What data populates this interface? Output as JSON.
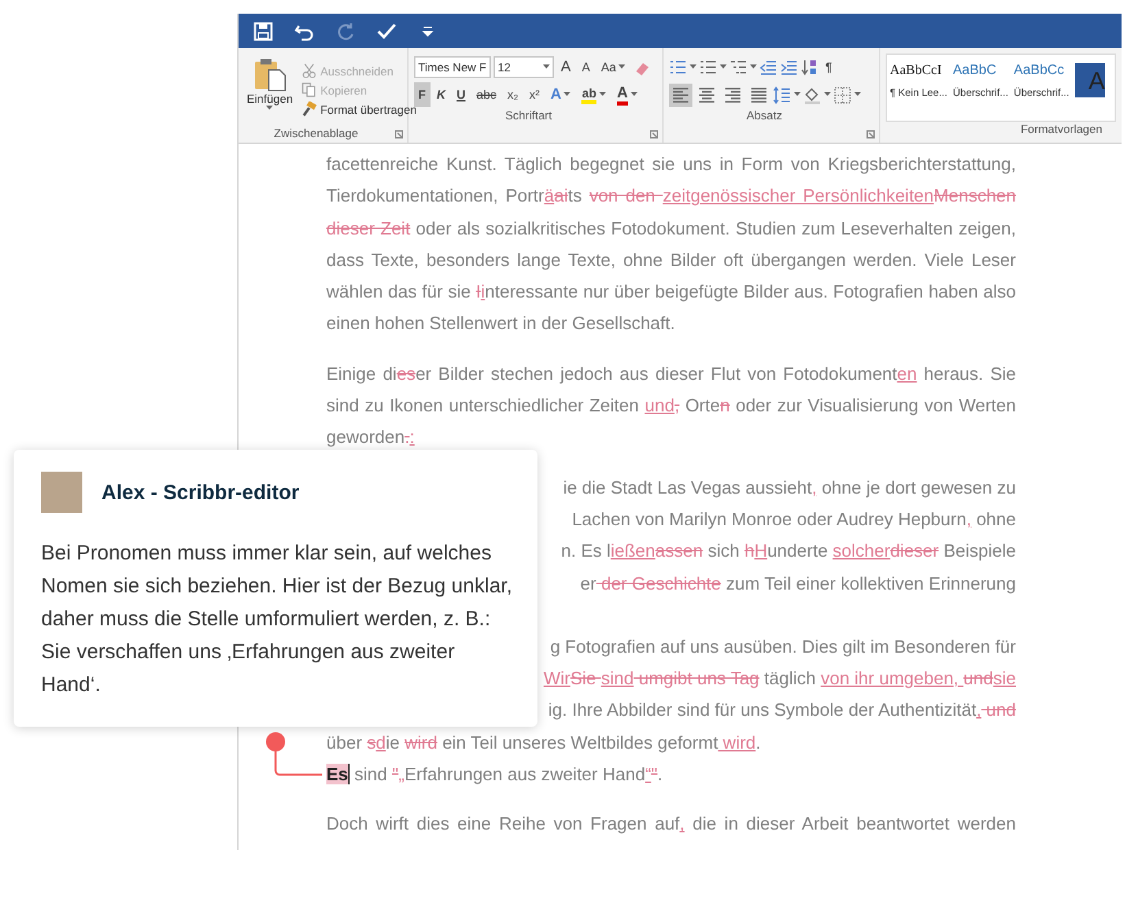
{
  "quick_access": [
    {
      "kind": "save",
      "disabled": false
    },
    {
      "kind": "undo",
      "disabled": false
    },
    {
      "kind": "redo",
      "disabled": true
    },
    {
      "kind": "check",
      "disabled": false
    },
    {
      "kind": "customize",
      "disabled": false
    }
  ],
  "ribbon": {
    "clipboard": {
      "label": "Zwischenablage",
      "paste": "Einfügen",
      "commands": [
        {
          "label": "Ausschneiden",
          "kind": "cut",
          "disabled": true
        },
        {
          "label": "Kopieren",
          "kind": "copy",
          "disabled": true
        },
        {
          "label": "Format übertragen",
          "kind": "painter",
          "disabled": false
        }
      ]
    },
    "font": {
      "label": "Schriftart",
      "font_name": "Times New F",
      "font_size": "12",
      "size_buttons": [
        "A",
        "A"
      ],
      "case_button": "Aa",
      "format_buttons": [
        {
          "label": "F",
          "selected": true
        },
        {
          "label": "K",
          "selected": false
        },
        {
          "label": "U",
          "selected": false
        },
        {
          "label": "abc",
          "selected": false
        },
        {
          "label": "x₂",
          "selected": false
        },
        {
          "label": "x²",
          "selected": false
        }
      ],
      "effect_buttons": [
        {
          "label": "A",
          "kind": "effects"
        },
        {
          "label": "ab",
          "kind": "highlight"
        },
        {
          "label": "A",
          "kind": "color"
        }
      ]
    },
    "paragraph": {
      "label": "Absatz",
      "pilcrow": "¶",
      "alignment": [
        {
          "kind": "left",
          "selected": true
        },
        {
          "kind": "center",
          "selected": false
        },
        {
          "kind": "right",
          "selected": false
        },
        {
          "kind": "justify",
          "selected": false
        }
      ]
    },
    "styles": {
      "label": "Formatvorlagen",
      "items": [
        {
          "sample": "AaBbCcI",
          "name": "¶ Kein Lee...",
          "kind": "normal"
        },
        {
          "sample": "AaBbC",
          "name": "Überschrif...",
          "kind": "heading"
        },
        {
          "sample": "AaBbCc",
          "name": "Überschrif...",
          "kind": "heading"
        },
        {
          "sample": "A",
          "kind": "title"
        }
      ]
    }
  },
  "document": {
    "paragraphs": [
      {
        "lines": [
          {
            "kind": "full",
            "segments": [
              {
                "kind": "text",
                "text": "facettenreiche Kunst. Täglich begegnet sie uns in Form von Kriegsberichterstattung,"
              }
            ]
          },
          {
            "kind": "full",
            "segments": [
              {
                "kind": "text",
                "text": "Tierdokumentationen, Portr"
              },
              {
                "kind": "ins",
                "text": "ä"
              },
              {
                "kind": "del",
                "text": "ai"
              },
              {
                "kind": "text",
                "text": "ts "
              },
              {
                "kind": "del",
                "text": "von den "
              },
              {
                "kind": "ins",
                "text": "zeitgenössischer Persönlichkeiten"
              },
              {
                "kind": "del",
                "text": "Menschen"
              }
            ]
          },
          {
            "kind": "full",
            "segments": [
              {
                "kind": "del",
                "text": "dieser Zeit"
              },
              {
                "kind": "text",
                "text": " oder als sozialkritisches Fotodokument. Studien zum Leseverhalten zeigen,"
              }
            ]
          },
          {
            "kind": "full",
            "segments": [
              {
                "kind": "text",
                "text": "dass Texte, besonders lange Texte, ohne Bilder oft übergangen werden. Viele Leser"
              }
            ]
          },
          {
            "kind": "full",
            "segments": [
              {
                "kind": "text",
                "text": "wählen das für sie "
              },
              {
                "kind": "del",
                "text": "I"
              },
              {
                "kind": "ins",
                "text": "i"
              },
              {
                "kind": "text",
                "text": "nteressante nur über beigefügte Bilder aus. Fotografien haben also"
              }
            ]
          },
          {
            "kind": "last",
            "segments": [
              {
                "kind": "text",
                "text": "einen hohen Stellenwert in der Gesellschaft."
              }
            ]
          }
        ]
      },
      {
        "lines": [
          {
            "kind": "full",
            "segments": [
              {
                "kind": "text",
                "text": "Einige di"
              },
              {
                "kind": "del",
                "text": "es"
              },
              {
                "kind": "text",
                "text": "er Bilder stechen jedoch aus dieser Flut von Fotodokument"
              },
              {
                "kind": "ins",
                "text": "en"
              },
              {
                "kind": "text",
                "text": " heraus. Sie"
              }
            ]
          },
          {
            "kind": "full",
            "segments": [
              {
                "kind": "text",
                "text": "sind zu Ikonen unterschiedlicher Zeiten "
              },
              {
                "kind": "ins",
                "text": "und"
              },
              {
                "kind": "del",
                "text": ","
              },
              {
                "kind": "text",
                "text": " Orte"
              },
              {
                "kind": "del",
                "text": "n"
              },
              {
                "kind": "text",
                "text": " oder zur Visualisierung von Werten"
              }
            ]
          },
          {
            "kind": "last",
            "segments": [
              {
                "kind": "text",
                "text": "geworden"
              },
              {
                "kind": "del",
                "text": "."
              },
              {
                "kind": "ins",
                "text": ":"
              }
            ]
          }
        ]
      },
      {
        "lines": [
          {
            "kind": "clipped",
            "segments": [
              {
                "kind": "text",
                "text": "ie die Stadt Las Vegas aussieht"
              },
              {
                "kind": "ins",
                "text": ","
              },
              {
                "kind": "text",
                "text": " ohne je dort gewesen zu"
              }
            ]
          },
          {
            "kind": "clipped",
            "segments": [
              {
                "kind": "text",
                "text": "Lachen von Marilyn Monroe oder Audrey Hepburn"
              },
              {
                "kind": "ins",
                "text": ","
              },
              {
                "kind": "text",
                "text": " ohne"
              }
            ]
          },
          {
            "kind": "clipped",
            "segments": [
              {
                "kind": "text",
                "text": "n. Es l"
              },
              {
                "kind": "ins",
                "text": "ießen"
              },
              {
                "kind": "del",
                "text": "assen"
              },
              {
                "kind": "text",
                "text": " sich "
              },
              {
                "kind": "del",
                "text": "h"
              },
              {
                "kind": "ins",
                "text": "H"
              },
              {
                "kind": "text",
                "text": "underte "
              },
              {
                "kind": "ins",
                "text": "solcher"
              },
              {
                "kind": "del",
                "text": "dieser"
              },
              {
                "kind": "text",
                "text": " Beispiele"
              }
            ]
          },
          {
            "kind": "clipped",
            "segments": [
              {
                "kind": "text",
                "text": "er"
              },
              {
                "kind": "del",
                "text": " der Geschichte"
              },
              {
                "kind": "text",
                "text": " zum Teil einer kollektiven Erinnerung"
              }
            ]
          }
        ]
      },
      {
        "lines": [
          {
            "kind": "clipped",
            "segments": [
              {
                "kind": "text",
                "text": "g Fotografien auf uns ausüben. Dies gilt im Besonderen für"
              }
            ]
          },
          {
            "kind": "clipped",
            "segments": [
              {
                "kind": "ins",
                "text": "Wir"
              },
              {
                "kind": "del",
                "text": "Sie "
              },
              {
                "kind": "ins",
                "text": "sind"
              },
              {
                "kind": "del",
                "text": " umgibt uns Tag"
              },
              {
                "kind": "text",
                "text": " täglich "
              },
              {
                "kind": "ins",
                "text": "von ihr umgeben, "
              },
              {
                "kind": "del",
                "text": "und"
              },
              {
                "kind": "ins",
                "text": "sie"
              }
            ]
          },
          {
            "kind": "clipped",
            "segments": [
              {
                "kind": "text",
                "text": "ig. Ihre Abbilder sind für uns Symbole der Authentizität"
              },
              {
                "kind": "ins",
                "text": ","
              },
              {
                "kind": "del",
                "text": " und"
              }
            ]
          },
          {
            "kind": "last",
            "segments": [
              {
                "kind": "text",
                "text": "über "
              },
              {
                "kind": "del",
                "text": "s"
              },
              {
                "kind": "ins",
                "text": "d"
              },
              {
                "kind": "text",
                "text": "ie "
              },
              {
                "kind": "del",
                "text": "wird"
              },
              {
                "kind": "text",
                "text": " ein Teil unseres Weltbildes geformt"
              },
              {
                "kind": "ins",
                "text": " wird"
              },
              {
                "kind": "text",
                "text": "."
              }
            ]
          },
          {
            "kind": "last",
            "segments": [
              {
                "kind": "commented",
                "text": "Es"
              },
              {
                "kind": "text",
                "text": " sind "
              },
              {
                "kind": "del",
                "text": "\""
              },
              {
                "kind": "ins",
                "text": "„"
              },
              {
                "kind": "text",
                "text": "Erfahrungen aus zweiter Hand"
              },
              {
                "kind": "ins",
                "text": "“"
              },
              {
                "kind": "del",
                "text": "\""
              },
              {
                "kind": "text",
                "text": "."
              }
            ]
          }
        ]
      },
      {
        "lines": [
          {
            "kind": "full",
            "segments": [
              {
                "kind": "text",
                "text": "Doch wirft dies eine Reihe von Fragen auf"
              },
              {
                "kind": "ins",
                "text": ","
              },
              {
                "kind": "text",
                "text": " die in dieser Arbeit beantwortet werden"
              }
            ]
          }
        ]
      }
    ]
  },
  "comment": {
    "author": "Alex - Scribbr-editor",
    "paragraphs": [
      "Bei Pronomen muss immer klar sein, auf welches Nomen sie sich beziehen. Hier ist der Bezug unklar, daher muss die Stelle umformuliert werden, z. B.:",
      "Sie verschaffen uns ‚Erfahrungen aus zweiter Hand‘."
    ]
  }
}
